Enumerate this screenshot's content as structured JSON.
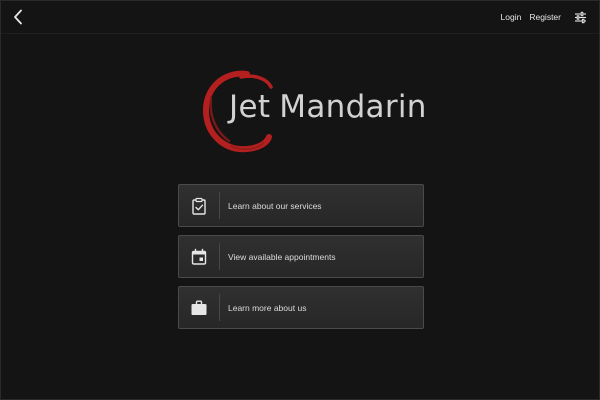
{
  "header": {
    "back_icon": "chevron-left-icon",
    "login_label": "Login",
    "register_label": "Register",
    "settings_icon": "sliders-icon"
  },
  "logo": {
    "word1": "Jet",
    "word2": "Mandarin",
    "ring_color": "#b3201f",
    "text_color": "#d2d2d2"
  },
  "menu": {
    "items": [
      {
        "label": "Learn about our services",
        "icon": "clipboard-check-icon"
      },
      {
        "label": "View available appointments",
        "icon": "calendar-icon"
      },
      {
        "label": "Learn more about us",
        "icon": "briefcase-icon"
      }
    ]
  },
  "colors": {
    "background": "#141414",
    "button_bg": "#2c2c2c",
    "button_border": "#4a4a4a",
    "text": "#dcdcdc"
  }
}
